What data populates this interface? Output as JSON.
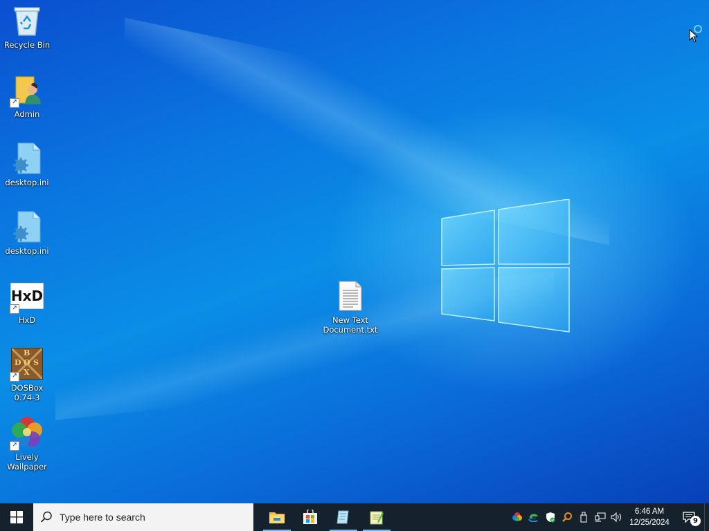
{
  "desktop": {
    "icons": [
      {
        "label": "Recycle Bin"
      },
      {
        "label": "Admin"
      },
      {
        "label": "desktop.ini"
      },
      {
        "label": "desktop.ini"
      },
      {
        "label": "HxD"
      },
      {
        "label": "DOSBox\n0.74-3"
      },
      {
        "label": "Lively\nWallpaper"
      },
      {
        "label": "New Text\nDocument.txt"
      }
    ],
    "hxd_glyph": "HxD",
    "dosbox_letters": [
      "B",
      "D",
      "O",
      "S",
      "X"
    ]
  },
  "taskbar": {
    "search_placeholder": "Type here to search",
    "apps": [
      "file-explorer",
      "microsoft-store",
      "notepad-plus-plus",
      "notepad"
    ],
    "tray_icons": [
      "lively-icon",
      "edge-update-icon",
      "defender-icon",
      "search-tool-icon",
      "usb-icon",
      "network-icon",
      "volume-icon"
    ],
    "clock": {
      "time": "6:46 AM",
      "date": "12/25/2024"
    },
    "notification_count": "9"
  },
  "colors": {
    "taskbar_bg": "#16212e",
    "wallpaper_blue": "#0a78e0",
    "accent": "#7fb2e8"
  }
}
